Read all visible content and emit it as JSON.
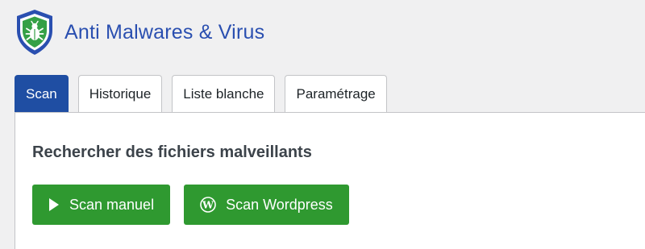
{
  "app": {
    "title": "Anti Malwares & Virus"
  },
  "tabs": [
    {
      "label": "Scan",
      "active": true
    },
    {
      "label": "Historique",
      "active": false
    },
    {
      "label": "Liste blanche",
      "active": false
    },
    {
      "label": "Paramétrage",
      "active": false
    }
  ],
  "main": {
    "heading": "Rechercher des fichiers malveillants",
    "buttons": [
      {
        "label": "Scan manuel",
        "icon": "play-icon"
      },
      {
        "label": "Scan Wordpress",
        "icon": "wordpress-icon"
      }
    ]
  },
  "colors": {
    "brand_blue": "#2a4fb0",
    "active_tab": "#1f4ea3",
    "button_green": "#2f9930",
    "shield_green": "#35a046",
    "background": "#f0f0f1"
  }
}
